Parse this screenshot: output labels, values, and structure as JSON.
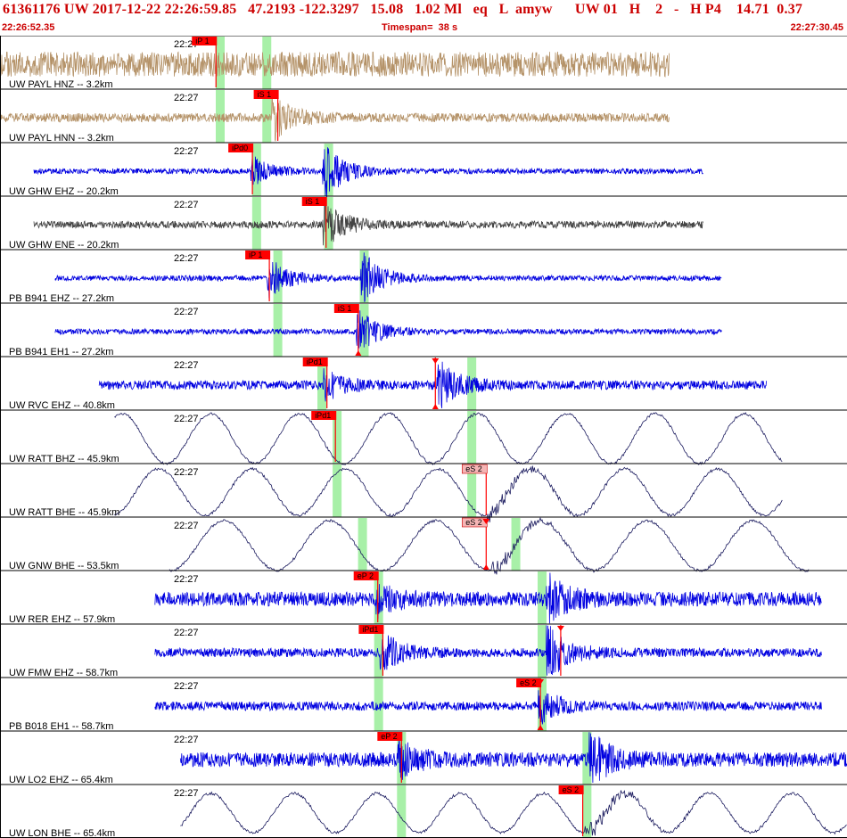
{
  "header": {
    "title": "61361176 UW 2017-12-22 22:26:59.85   47.2193 -122.3297   15.08   1.02 Ml   eq   L  amyw      UW 01   H    2   -   H P4    14.71  0.37",
    "start_time": "22:26:52.35",
    "timespan": "Timespan=  38 s",
    "end_time": "22:27:30.45"
  },
  "colors": {
    "tan": "#b59369",
    "blue": "#0000e0",
    "dark": "#444444",
    "navy": "#1a1a5e",
    "pick_red": "#ff0000",
    "pick_pink": "#f5b5b5",
    "window_green": "#a8f0a8"
  },
  "traces": [
    {
      "label": "UW PAYL HNZ -- 3.2km",
      "time": "22:27",
      "color": "tan",
      "type": "noise",
      "start": 0.0,
      "end": 0.79,
      "amp": 14,
      "seed": 1,
      "windows": [
        0.26,
        0.315
      ],
      "picks": [
        {
          "text": "iP 1",
          "pos": 0.255,
          "style": "red",
          "side": "left"
        }
      ],
      "events": []
    },
    {
      "label": "UW PAYL HNN -- 3.2km",
      "time": "22:27",
      "color": "tan",
      "type": "noise",
      "start": 0.0,
      "end": 0.79,
      "amp": 5,
      "seed": 2,
      "windows": [
        0.26,
        0.315
      ],
      "picks": [
        {
          "text": "iS 1",
          "pos": 0.328,
          "style": "red",
          "side": "left"
        }
      ],
      "events": [
        {
          "pos": 0.325,
          "amp": 22
        }
      ]
    },
    {
      "label": "UW GHW EHZ -- 20.2km",
      "time": "22:27",
      "color": "blue",
      "type": "noise",
      "start": 0.04,
      "end": 0.83,
      "amp": 3,
      "seed": 3,
      "windows": [
        0.303,
        0.388
      ],
      "picks": [
        {
          "text": "iPd0",
          "pos": 0.298,
          "style": "red",
          "side": "left"
        }
      ],
      "events": [
        {
          "pos": 0.3,
          "amp": 14
        },
        {
          "pos": 0.385,
          "amp": 28
        }
      ]
    },
    {
      "label": "UW GHW ENE -- 20.2km",
      "time": "22:27",
      "color": "dark",
      "type": "noise",
      "start": 0.04,
      "end": 0.83,
      "amp": 4,
      "seed": 4,
      "windows": [
        0.303,
        0.388
      ],
      "picks": [
        {
          "text": "iS 1",
          "pos": 0.385,
          "style": "red",
          "side": "left"
        }
      ],
      "events": [
        {
          "pos": 0.385,
          "amp": 24
        }
      ]
    },
    {
      "label": "PB B941 EHZ -- 27.2km",
      "time": "22:27",
      "color": "blue",
      "type": "noise",
      "start": 0.065,
      "end": 0.852,
      "amp": 3,
      "seed": 5,
      "windows": [
        0.328,
        0.43
      ],
      "picks": [
        {
          "text": "iP 1",
          "pos": 0.318,
          "style": "red",
          "side": "left"
        }
      ],
      "events": [
        {
          "pos": 0.32,
          "amp": 20
        },
        {
          "pos": 0.43,
          "amp": 26
        }
      ]
    },
    {
      "label": "PB B941 EH1 -- 27.2km",
      "time": "22:27",
      "color": "blue",
      "type": "noise",
      "start": 0.065,
      "end": 0.852,
      "amp": 3,
      "seed": 6,
      "windows": [
        0.328,
        0.43
      ],
      "picks": [
        {
          "text": "iS 1",
          "pos": 0.423,
          "style": "red",
          "side": "left",
          "tri": true
        }
      ],
      "events": [
        {
          "pos": 0.425,
          "amp": 22
        }
      ]
    },
    {
      "label": "UW RVC EHZ -- 40.8km",
      "time": "22:27",
      "color": "blue",
      "type": "noise",
      "start": 0.117,
      "end": 0.905,
      "amp": 5,
      "seed": 7,
      "windows": [
        0.38,
        0.557
      ],
      "picks": [
        {
          "text": "iPd1",
          "pos": 0.386,
          "style": "red",
          "side": "left"
        },
        {
          "text": "",
          "pos": 0.514,
          "style": "red",
          "side": "left",
          "tri": true,
          "dtri": true
        }
      ],
      "events": [
        {
          "pos": 0.387,
          "amp": 14
        },
        {
          "pos": 0.52,
          "amp": 24
        }
      ]
    },
    {
      "label": "UW RATT BHZ -- 45.9km",
      "time": "22:27",
      "color": "navy",
      "type": "wave",
      "start": 0.135,
      "end": 0.924,
      "amp": 28,
      "period": 0.105,
      "phase": 2.4,
      "seed": 8,
      "windows": [
        0.398,
        0.557
      ],
      "picks": [
        {
          "text": "iPd1",
          "pos": 0.396,
          "style": "red",
          "side": "left"
        }
      ],
      "events": []
    },
    {
      "label": "UW RATT BHE -- 45.9km",
      "time": "22:27",
      "color": "navy",
      "type": "wave",
      "start": 0.135,
      "end": 0.924,
      "amp": 26,
      "period": 0.11,
      "phase": 0.3,
      "seed": 9,
      "windows": [
        0.398,
        0.557
      ],
      "picks": [
        {
          "text": "eS 2",
          "pos": 0.574,
          "style": "pink",
          "side": "left"
        }
      ],
      "events": [
        {
          "pos": 0.575,
          "amp": 10
        }
      ]
    },
    {
      "label": "UW GNW BHE -- 53.5km",
      "time": "22:27",
      "color": "navy",
      "type": "wave",
      "start": 0.2,
      "end": 0.955,
      "amp": 28,
      "period": 0.125,
      "phase": 4.0,
      "seed": 10,
      "windows": [
        0.428,
        0.609
      ],
      "picks": [
        {
          "text": "eS 2",
          "pos": 0.574,
          "style": "pink",
          "side": "left",
          "tri": true,
          "dtri": true
        }
      ],
      "events": [
        {
          "pos": 0.58,
          "amp": 10
        }
      ]
    },
    {
      "label": "UW RER EHZ -- 57.9km",
      "time": "22:27",
      "color": "blue",
      "type": "noise",
      "start": 0.183,
      "end": 0.97,
      "amp": 8,
      "seed": 11,
      "windows": [
        0.447,
        0.64
      ],
      "picks": [
        {
          "text": "eP 2",
          "pos": 0.446,
          "style": "red",
          "side": "left"
        }
      ],
      "events": [
        {
          "pos": 0.447,
          "amp": 16
        },
        {
          "pos": 0.65,
          "amp": 22
        }
      ]
    },
    {
      "label": "UW FMW EHZ -- 58.7km",
      "time": "22:27",
      "color": "blue",
      "type": "noise",
      "start": 0.183,
      "end": 0.97,
      "amp": 5,
      "seed": 12,
      "windows": [
        0.447,
        0.64
      ],
      "picks": [
        {
          "text": "iPd1",
          "pos": 0.452,
          "style": "red",
          "side": "left"
        },
        {
          "text": "",
          "pos": 0.662,
          "style": "red",
          "side": "left",
          "dtri": true
        }
      ],
      "events": [
        {
          "pos": 0.453,
          "amp": 20
        },
        {
          "pos": 0.65,
          "amp": 26
        }
      ]
    },
    {
      "label": "PB B018 EH1 -- 58.7km",
      "time": "22:27",
      "color": "blue",
      "type": "noise",
      "start": 0.183,
      "end": 0.97,
      "amp": 5,
      "seed": 13,
      "windows": [
        0.447,
        0.64
      ],
      "picks": [
        {
          "text": "eS 2",
          "pos": 0.638,
          "style": "red",
          "side": "left",
          "tri": true,
          "dtri": true
        }
      ],
      "events": [
        {
          "pos": 0.64,
          "amp": 18
        }
      ]
    },
    {
      "label": "UW LO2 EHZ -- 65.4km",
      "time": "22:27",
      "color": "blue",
      "type": "noise",
      "start": 0.213,
      "end": 1.0,
      "amp": 8,
      "seed": 14,
      "windows": [
        0.474,
        0.693
      ],
      "picks": [
        {
          "text": "eP 2",
          "pos": 0.474,
          "style": "red",
          "side": "left"
        }
      ],
      "events": [
        {
          "pos": 0.474,
          "amp": 16
        },
        {
          "pos": 0.7,
          "amp": 24
        }
      ]
    },
    {
      "label": "UW LON BHE -- 65.4km",
      "time": "22:27",
      "color": "navy",
      "type": "wave",
      "start": 0.213,
      "end": 1.0,
      "amp": 22,
      "period": 0.098,
      "phase": 1.3,
      "seed": 15,
      "windows": [
        0.474,
        0.693
      ],
      "picks": [
        {
          "text": "eS 2",
          "pos": 0.688,
          "style": "red",
          "side": "left"
        }
      ],
      "events": [
        {
          "pos": 0.69,
          "amp": 12
        }
      ]
    }
  ]
}
